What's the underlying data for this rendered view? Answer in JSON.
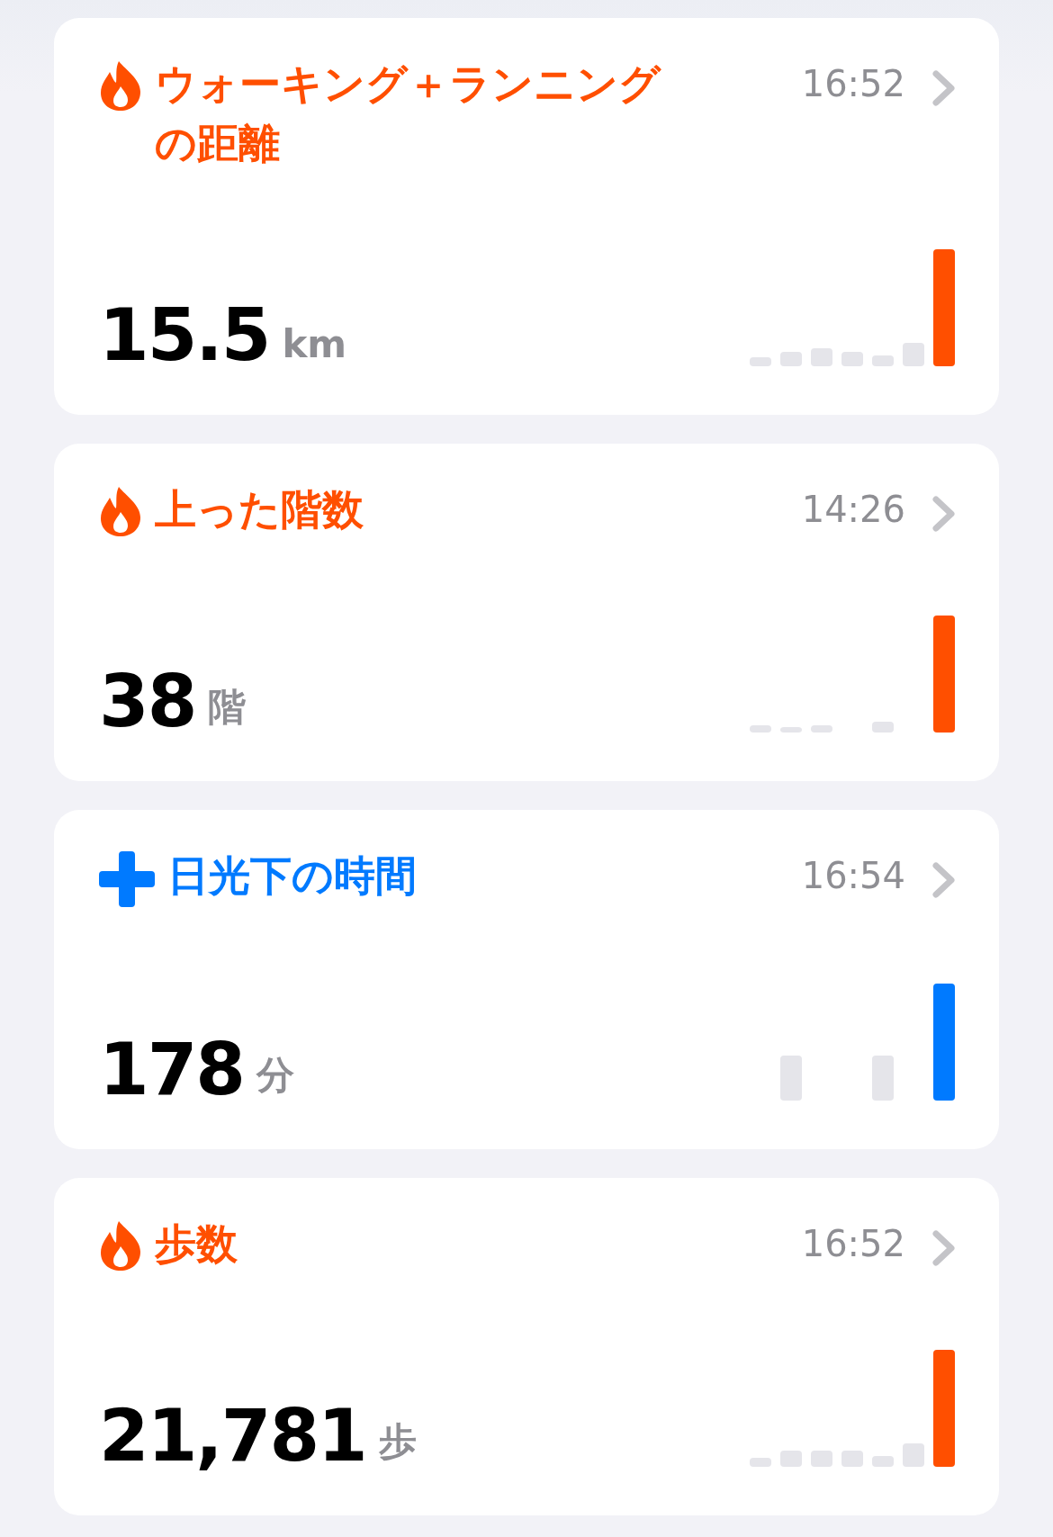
{
  "cards": [
    {
      "kind": "flame",
      "color": "#ff4f00",
      "title": "ウォーキング＋ランニングの距離",
      "time": "16:52",
      "value": "15.5",
      "unit": "km"
    },
    {
      "kind": "flame",
      "color": "#ff4f00",
      "title": "上った階数",
      "time": "14:26",
      "value": "38",
      "unit": "階"
    },
    {
      "kind": "cross",
      "color": "#007aff",
      "title": "日光下の時間",
      "time": "16:54",
      "value": "178",
      "unit": "分"
    },
    {
      "kind": "flame",
      "color": "#ff4f00",
      "title": "歩数",
      "time": "16:52",
      "value": "21,781",
      "unit": "歩"
    }
  ]
}
